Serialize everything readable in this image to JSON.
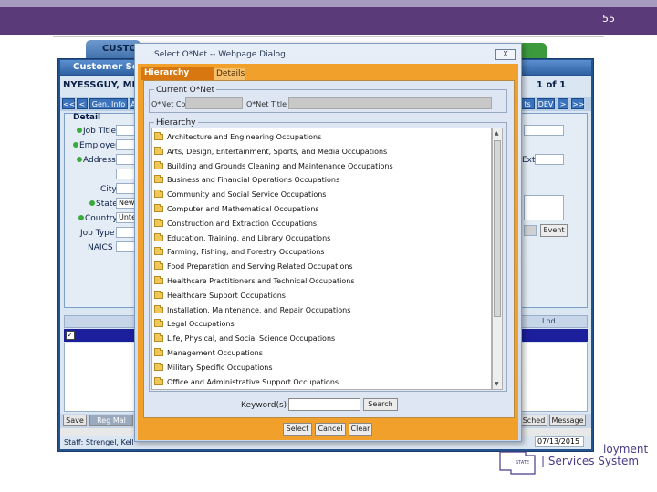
{
  "slide": {
    "page_number": "55"
  },
  "app": {
    "tab_label": "CUSTO",
    "title": "Customer Search",
    "customer_name": "NYESSGUY, MR",
    "record_count": "1 of 1",
    "nav_buttons": [
      "<<",
      "<",
      "Gen. Info",
      "A"
    ],
    "nav_right": [
      "ts",
      "DEV",
      ">",
      ">>"
    ],
    "detail_label": "Detail",
    "fields": {
      "job_title": "Job Title",
      "employer": "Employer",
      "address": "Address",
      "city": "City",
      "state": "State",
      "state_value": "New",
      "country": "Country",
      "country_value": "Unte",
      "job_type": "Job Type",
      "naics": "NAICS",
      "ext": "Ext",
      "event_button": "Event"
    },
    "grid": {
      "header_right": "Lnd"
    },
    "bottom_buttons": [
      "Save",
      "Reg Mal",
      "Sched",
      "Message"
    ],
    "status_staff": "Staff: Strengel, Kell",
    "status_date": "07/13/2015"
  },
  "dialog": {
    "title": "Select O*Net -- Webpage Dialog",
    "close_glyph": "X",
    "tabs": [
      {
        "label": "Hierarchy Search",
        "active": true
      },
      {
        "label": "Details",
        "active": false
      }
    ],
    "current": {
      "legend": "Current O*Net",
      "code_label": "O*Net Code",
      "code_value": "",
      "title_label": "O*Net Title",
      "title_value": ""
    },
    "hierarchy": {
      "legend": "Hierarchy",
      "items": [
        "Architecture and Engineering Occupations",
        "Arts, Design, Entertainment, Sports, and Media Occupations",
        "Building and Grounds Cleaning and Maintenance Occupations",
        "Business and Financial Operations Occupations",
        "Community and Social Service Occupations",
        "Computer and Mathematical Occupations",
        "Construction and Extraction Occupations",
        "Education, Training, and Library Occupations",
        "Farming, Fishing, and Forestry Occupations",
        "Food Preparation and Serving Related Occupations",
        "Healthcare Practitioners and Technical Occupations",
        "Healthcare Support Occupations",
        "Installation, Maintenance, and Repair Occupations",
        "Legal Occupations",
        "Life, Physical, and Social Science Occupations",
        "Management Occupations",
        "Military Specific Occupations",
        "Office and Administrative Support Occupations"
      ]
    },
    "keyword": {
      "label": "Keyword(s)",
      "value": "",
      "search_button": "Search"
    },
    "buttons": {
      "select": "Select",
      "cancel": "Cancel",
      "clear": "Clear"
    }
  },
  "logo": {
    "line1": "loyment",
    "line2": "Services System",
    "state_word": "STATE"
  },
  "colors": {
    "header": "#5a3a78",
    "dialog_frame": "#f2a02c",
    "app_blue": "#23528f",
    "selected_row": "#1b1f9c"
  }
}
